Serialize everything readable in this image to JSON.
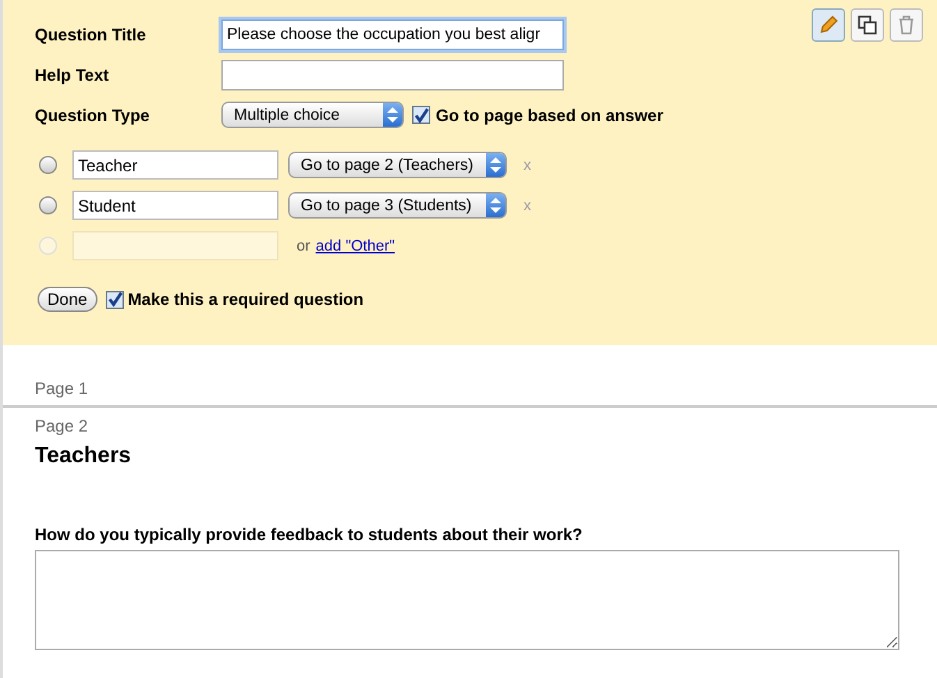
{
  "editor": {
    "toolbar": [
      {
        "kind": "edit",
        "selected": true
      },
      {
        "kind": "duplicate",
        "selected": false
      },
      {
        "kind": "delete",
        "selected": false
      }
    ],
    "fields": [
      {
        "label": "Question Title",
        "value": "Please choose the occupation you best aligr",
        "focused": true
      },
      {
        "label": "Help Text",
        "focused": false
      }
    ],
    "question_type": {
      "label": "Question Type",
      "value": "Multiple choice",
      "go_to_page": {
        "label": "Go to page based on answer",
        "checked": true
      }
    },
    "options": [
      {
        "kind": "choice",
        "selected": false,
        "value": "Teacher",
        "destination": "Go to page 2 (Teachers)",
        "remove": "x"
      },
      {
        "kind": "choice",
        "selected": false,
        "value": "Student",
        "destination": "Go to page 3 (Students)",
        "remove": "x"
      },
      {
        "kind": "new",
        "selected": false,
        "or": "or",
        "link": "add \"Other\""
      }
    ],
    "done": "Done",
    "required": {
      "label": "Make this a required question",
      "checked": true
    }
  },
  "pages": [
    {
      "label": "Page 1"
    },
    {
      "label": "Page 2",
      "title": "Teachers",
      "questions": [
        {
          "text": "How do you typically provide feedback to students about their work?"
        }
      ]
    }
  ]
}
